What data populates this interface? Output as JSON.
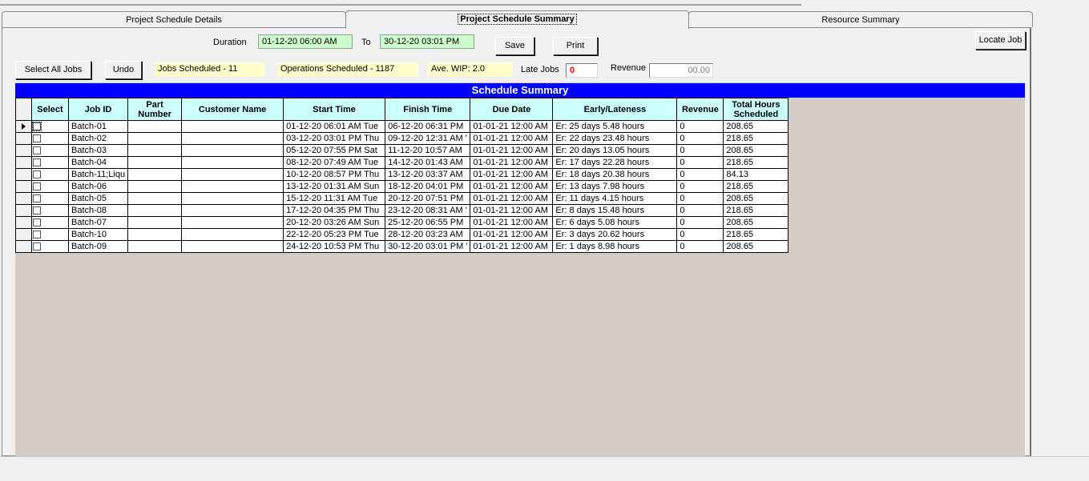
{
  "tabs": [
    {
      "label": "Project Schedule Details"
    },
    {
      "label": "Project Schedule Summary"
    },
    {
      "label": "Resource Summary"
    }
  ],
  "toolbar": {
    "duration_label": "Duration",
    "duration_from": "01-12-20 06:00 AM",
    "to_label": "To",
    "duration_to": "30-12-20 03:01 PM",
    "save_label": "Save",
    "print_label": "Print",
    "locate_job_label": "Locate Job",
    "select_all_label": "Select All Jobs",
    "undo_label": "Undo",
    "jobs_scheduled": "Jobs Scheduled - 11",
    "operations_scheduled": "Operations Scheduled - 1187",
    "ave_wip": "Ave. WIP:  2.0",
    "late_jobs_label": "Late Jobs",
    "late_jobs_value": "0",
    "revenue_label": "Revenue",
    "revenue_value": "00.00"
  },
  "grid": {
    "title": "Schedule Summary",
    "columns": [
      "Select",
      "Job ID",
      "Part Number",
      "Customer Name",
      "Start Time",
      "Finish Time",
      "Due Date",
      "Early/Lateness",
      "Revenue",
      "Total Hours Scheduled"
    ],
    "rows": [
      {
        "job": "Batch-01",
        "part": "",
        "customer": "",
        "start": "01-12-20 06:01 AM Tue",
        "finish": "06-12-20 06:31 PM",
        "due": "01-01-21 12:00 AM",
        "early": "Er: 25 days 5.48 hours",
        "revenue": "0",
        "hours": "208.65"
      },
      {
        "job": "Batch-02",
        "part": "",
        "customer": "",
        "start": "03-12-20 03:01 PM Thu",
        "finish": "09-12-20 12:31 AM '",
        "due": "01-01-21 12:00 AM",
        "early": "Er: 22 days 23.48 hours",
        "revenue": "0",
        "hours": "218.65"
      },
      {
        "job": "Batch-03",
        "part": "",
        "customer": "",
        "start": "05-12-20 07:55 PM Sat",
        "finish": "11-12-20 10:57 AM",
        "due": "01-01-21 12:00 AM",
        "early": "Er: 20 days 13.05 hours",
        "revenue": "0",
        "hours": "208.65"
      },
      {
        "job": "Batch-04",
        "part": "",
        "customer": "",
        "start": "08-12-20 07:49 AM Tue",
        "finish": "14-12-20 01:43 AM",
        "due": "01-01-21 12:00 AM",
        "early": "Er: 17 days 22.28 hours",
        "revenue": "0",
        "hours": "218.65"
      },
      {
        "job": "Batch-11;Liqu",
        "part": "",
        "customer": "",
        "start": "10-12-20 08:57 PM Thu",
        "finish": "13-12-20 03:37 AM",
        "due": "01-01-21 12:00 AM",
        "early": "Er: 18 days 20.38 hours",
        "revenue": "0",
        "hours": "84.13"
      },
      {
        "job": "Batch-06",
        "part": "",
        "customer": "",
        "start": "13-12-20 01:31 AM Sun",
        "finish": "18-12-20 04:01 PM",
        "due": "01-01-21 12:00 AM",
        "early": "Er: 13 days 7.98 hours",
        "revenue": "0",
        "hours": "218.65"
      },
      {
        "job": "Batch-05",
        "part": "",
        "customer": "",
        "start": "15-12-20 11:31 AM Tue",
        "finish": "20-12-20 07:51 PM",
        "due": "01-01-21 12:00 AM",
        "early": "Er: 11 days 4.15 hours",
        "revenue": "0",
        "hours": "208.65"
      },
      {
        "job": "Batch-08",
        "part": "",
        "customer": "",
        "start": "17-12-20 04:35 PM Thu",
        "finish": "23-12-20 08:31 AM '",
        "due": "01-01-21 12:00 AM",
        "early": "Er: 8 days 15.48 hours",
        "revenue": "0",
        "hours": "218.65"
      },
      {
        "job": "Batch-07",
        "part": "",
        "customer": "",
        "start": "20-12-20 03:26 AM Sun",
        "finish": "25-12-20 06:55 PM",
        "due": "01-01-21 12:00 AM",
        "early": "Er: 6 days 5.08 hours",
        "revenue": "0",
        "hours": "208.65"
      },
      {
        "job": "Batch-10",
        "part": "",
        "customer": "",
        "start": "22-12-20 05:23 PM Tue",
        "finish": "28-12-20 03:23 AM",
        "due": "01-01-21 12:00 AM",
        "early": "Er: 3 days 20.62 hours",
        "revenue": "0",
        "hours": "218.65"
      },
      {
        "job": "Batch-09",
        "part": "",
        "customer": "",
        "start": "24-12-20 10:53 PM Thu",
        "finish": "30-12-20 03:01 PM '",
        "due": "01-01-21 12:00 AM",
        "early": "Er: 1 days 8.98 hours",
        "revenue": "0",
        "hours": "208.65"
      }
    ]
  },
  "colors": {
    "title_bar": "#0000ff",
    "header_bg": "#ccffff",
    "date_field_bg": "#ccffcc",
    "info_field_bg": "#ffffcc",
    "grid_bg": "#d4ccc4",
    "late_value": "#ff0000"
  }
}
